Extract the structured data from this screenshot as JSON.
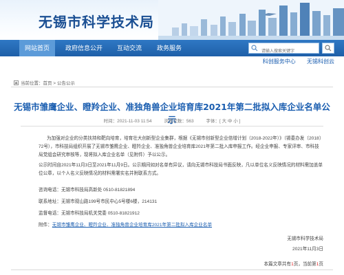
{
  "header": {
    "site_title": "无锡市科学技术局"
  },
  "nav": {
    "items": [
      {
        "label": "网站首页",
        "active": true
      },
      {
        "label": "政府信息公开",
        "active": false
      },
      {
        "label": "互动交流",
        "active": false
      },
      {
        "label": "政务服务",
        "active": false
      }
    ],
    "search_placeholder": "请输入搜索关键字"
  },
  "sublinks": [
    "科创服务中心",
    "无锡科创云"
  ],
  "breadcrumb": {
    "prefix": "当前位置：",
    "home": "首页",
    "sep": " > ",
    "current": "公告公示"
  },
  "article": {
    "title": "无锡市雏鹰企业、瞪羚企业、准独角兽企业培育库2021年第二批拟入库企业名单公示",
    "meta": {
      "time_label": "时间：",
      "time": "2021-11-03 11:54",
      "views_label": "浏览次数：",
      "views": "563",
      "font_label": "字体：",
      "font_sizes": [
        "[ 大",
        "中",
        "小 ]"
      ]
    },
    "p1": "为加强对企业的分类扶持和靶向培育，培育壮大创新型企业集群，根据《无锡市创新型企业倍增计划（2018-2022年）》（锡委办发〔2018〕72号），市科技局组织开展了无锡市雏鹰企业、瞪羚企业、准独角兽企业培育库2021年第二批入库申报工作。经企业申报、专家评审、市科技局党组会研究审核等，现将拟入库企业名单（见附件）予以公示。",
    "p2": "公示时间自2021年11月3日至2021年11月9日。公示期间如对名单有异议，请向无锡市科技局书面反映，凡以单位名义反映情况的材料需加盖单位公章，以个人名义反映情况的材料需署实名并附联系方式。",
    "contact_phone": "咨询电话：无锡市科技局高新处  0510-81821894",
    "contact_address": "联系地址：无锡市观山路199号市民中心5号楼6楼，214131",
    "supervision_phone": "监督电话：无锡市科技局机关党委  0510-81821912",
    "attachment_label": "附件：",
    "attachment_link": "无锡市雏鹰企业、瞪羚企业、准独角兽企业培育库2021年第二批拟入库企业名单",
    "sign_org": "无锡市科学技术局",
    "sign_date": "2021年11月3日"
  },
  "pager": {
    "prefix": "本篇文章共有",
    "total": "1",
    "mid": "页，当前第",
    "current": "1",
    "suffix": "页"
  },
  "colors": {
    "nav_bg": "#1e5fa8",
    "nav_active": "#5c9bd9",
    "title": "#1b5eb0",
    "link": "#1b5eb0",
    "pager_highlight": "#e02020"
  }
}
